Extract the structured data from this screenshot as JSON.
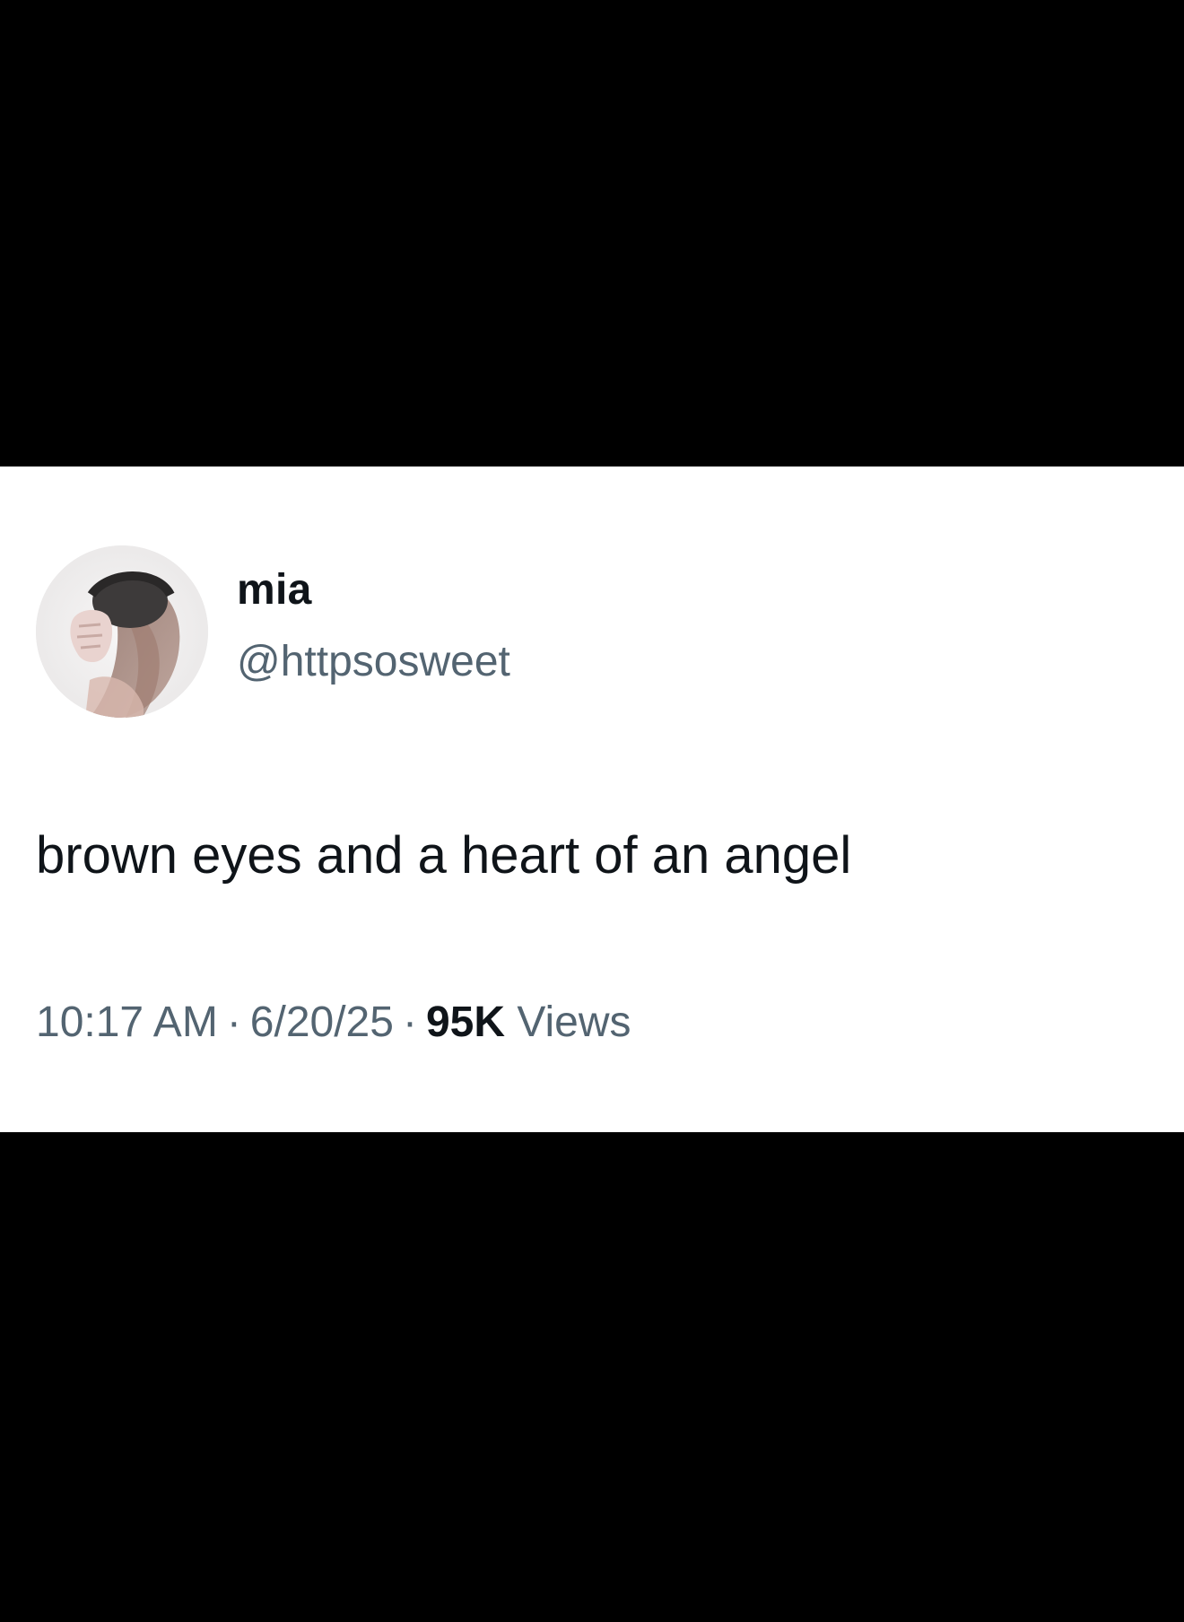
{
  "tweet": {
    "author": {
      "display_name": "mia",
      "handle": "@httpsosweet",
      "avatar_icon": "profile-photo"
    },
    "text": "brown eyes and a heart of an angel",
    "meta": {
      "time": "10:17 AM",
      "separator": "·",
      "date": "6/20/25",
      "views_count": "95K",
      "views_label": "Views"
    }
  },
  "colors": {
    "background_band": "#000000",
    "card": "#ffffff",
    "primary_text": "#0f1419",
    "secondary_text": "#536471"
  }
}
